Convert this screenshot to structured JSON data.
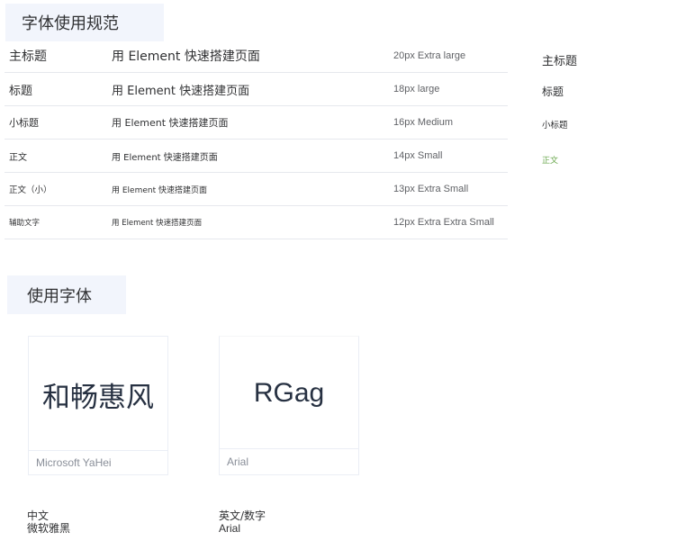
{
  "sections": {
    "typography_title": "字体使用规范",
    "fonts_title": "使用字体"
  },
  "type_scale": [
    {
      "name": "主标题",
      "example": "用 Element 快速搭建页面",
      "spec": "20px Extra large"
    },
    {
      "name": "标题",
      "example": "用 Element 快速搭建页面",
      "spec": "18px large"
    },
    {
      "name": "小标题",
      "example": "用 Element 快速搭建页面",
      "spec": "16px Medium"
    },
    {
      "name": "正文",
      "example": "用 Element 快速搭建页面",
      "spec": "14px Small"
    },
    {
      "name": "正文（小）",
      "example": "用 Element 快速搭建页面",
      "spec": "13px Extra Small"
    },
    {
      "name": "辅助文字",
      "example": "用 Element 快速搭建页面",
      "spec": "12px Extra Extra Small"
    }
  ],
  "samples": [
    {
      "label": "主标题",
      "color": "#303133"
    },
    {
      "label": "标题",
      "color": "#303133"
    },
    {
      "label": "小标题",
      "color": "#303133"
    },
    {
      "label": "正文",
      "color": "#67a64a"
    }
  ],
  "font_cards": [
    {
      "glyph": "和畅惠风",
      "font": "Microsoft YaHei"
    },
    {
      "glyph": "RGag",
      "font": "Arial"
    }
  ],
  "usage": [
    {
      "lang": "中文",
      "font": "微软雅黑"
    },
    {
      "lang": "英文/数字",
      "font": "Arial"
    }
  ]
}
